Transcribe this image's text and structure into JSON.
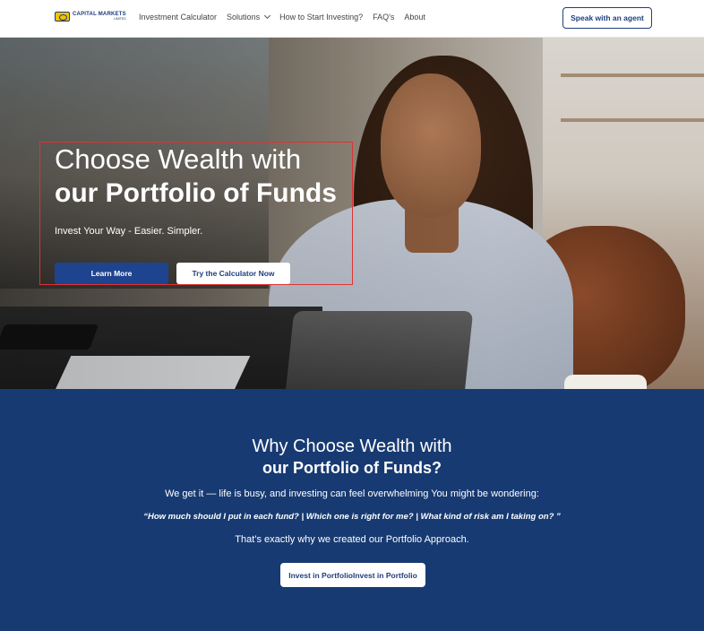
{
  "nav": {
    "logo_title": "CAPITAL MARKETS",
    "logo_sub": "LIMITED",
    "items": [
      {
        "label": "Investment Calculator"
      },
      {
        "label": "Solutions",
        "has_dropdown": true
      },
      {
        "label": "How to Start Investing?"
      },
      {
        "label": "FAQ's"
      },
      {
        "label": "About"
      }
    ],
    "agent_button": "Speak with an agent"
  },
  "hero": {
    "title_line1": "Choose Wealth with",
    "title_line2": "our Portfolio of Funds",
    "subtitle": "Invest Your Way - Easier. Simpler.",
    "primary_button": "Learn More",
    "secondary_button": "Try the Calculator Now"
  },
  "why": {
    "title_line1": "Why Choose Wealth with",
    "title_line2": "our Portfolio of Funds?",
    "paragraph1": "We get it — life is busy, and investing can feel overwhelming You might be wondering:",
    "questions": "“How much should I put in each fund?  | Which one is right for me?  |  What kind of risk am I taking on? ”",
    "paragraph2": "That’s exactly why we created our Portfolio Approach.",
    "button": "Invest in PortfolioInvest in Portfolio"
  },
  "colors": {
    "brand_navy": "#173a72",
    "button_blue": "#1e4490",
    "logo_yellow": "#f2c500",
    "highlight_red": "#dd3333"
  }
}
